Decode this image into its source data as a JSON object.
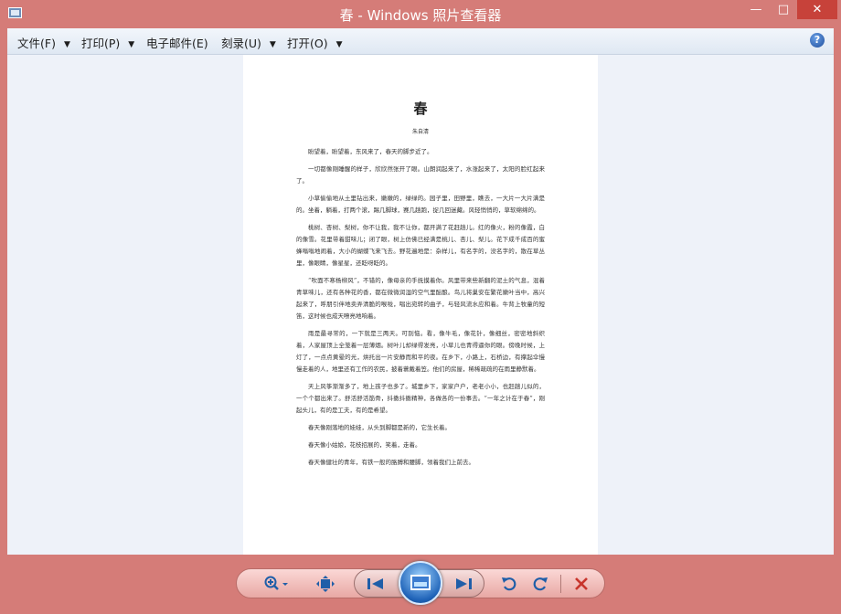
{
  "window": {
    "title": "春 - Windows 照片查看器"
  },
  "menu": [
    {
      "label": "文件(F)",
      "has_arrow": true
    },
    {
      "label": "打印(P)",
      "has_arrow": true
    },
    {
      "label": "电子邮件(E)",
      "has_arrow": false
    },
    {
      "label": "刻录(U)",
      "has_arrow": true
    },
    {
      "label": "打开(O)",
      "has_arrow": true
    }
  ],
  "document": {
    "title": "春",
    "author": "朱自清",
    "paragraphs": [
      "盼望着，盼望着，东风来了，春天的脚步近了。",
      "一切都像刚睡醒的样子，欣欣然张开了眼。山朗润起来了，水涨起来了，太阳的脸红起来了。",
      "小草偷偷地从土里钻出来，嫩嫩的，绿绿的。园子里，田野里，瞧去，一大片一大片满是的。坐着，躺着，打两个滚，踢几脚球，赛几趟跑，捉几回迷藏。风轻悄悄的，草软绵绵的。",
      "桃树、杏树、梨树，你不让我，我不让你，都开满了花赶趟儿。红的像火，粉的像霞，白的像雪。花里带着甜味儿；闭了眼，树上仿佛已经满是桃儿、杏儿、梨儿。花下成千成百的蜜蜂嗡嗡地闹着，大小的蝴蝶飞来飞去。野花遍地是：杂样儿，有名字的，没名字的，散在草丛里，像眼睛，像星星，还眨呀眨的。",
      "“吹面不寒杨柳风”，不错的，像母亲的手抚摸着你。风里带来些新翻的泥土的气息，混着青草味儿，还有各种花的香，都在微微润湿的空气里酝酿。鸟儿将巢安在繁花嫩叶当中，高兴起来了，呼朋引伴地卖弄清脆的喉咙，唱出宛转的曲子，与轻风流水应和着。牛背上牧童的短笛，这时候也成天嘹亮地响着。",
      "雨是最寻常的，一下就是三两天。可别恼。看，像牛毛，像花针，像细丝，密密地斜织着，人家屋顶上全笼着一层薄烟。树叶儿却绿得发亮，小草儿也青得逼你的眼。傍晚时候，上灯了，一点点黄晕的光，烘托出一片安静而和平的夜。在乡下，小路上，石桥边，有撑起伞慢慢走着的人，地里还有工作的农民，披着蓑戴着笠。他们的房屋，稀稀疏疏的在雨里静默着。",
      "天上风筝渐渐多了，地上孩子也多了。城里乡下，家家户户，老老小小，也赶趟儿似的，一个个都出来了。舒活舒活筋骨，抖擞抖擞精神，各做各的一份事去。“一年之计在于春”，刚起头儿，有的是工夫，有的是希望。",
      "春天像刚落地的娃娃，从头到脚都是新的，它生长着。",
      "春天像小姑娘，花枝招展的，笑着，走着。",
      "春天像健壮的青年，有铁一般的胳膊和腰脚，领着我们上前去。"
    ]
  },
  "icons": {
    "zoom": "zoom-icon",
    "actual_size": "actual-size-icon",
    "previous": "previous-icon",
    "slideshow": "slideshow-icon",
    "next": "next-icon",
    "rotate_ccw": "rotate-counterclockwise-icon",
    "rotate_cw": "rotate-clockwise-icon",
    "delete": "delete-icon",
    "help": "help-icon"
  },
  "colors": {
    "window_frame": "#d57c78",
    "viewer_bg": "#eef2f9",
    "control_icon": "#1f5ea8",
    "delete_icon": "#c8352c"
  }
}
